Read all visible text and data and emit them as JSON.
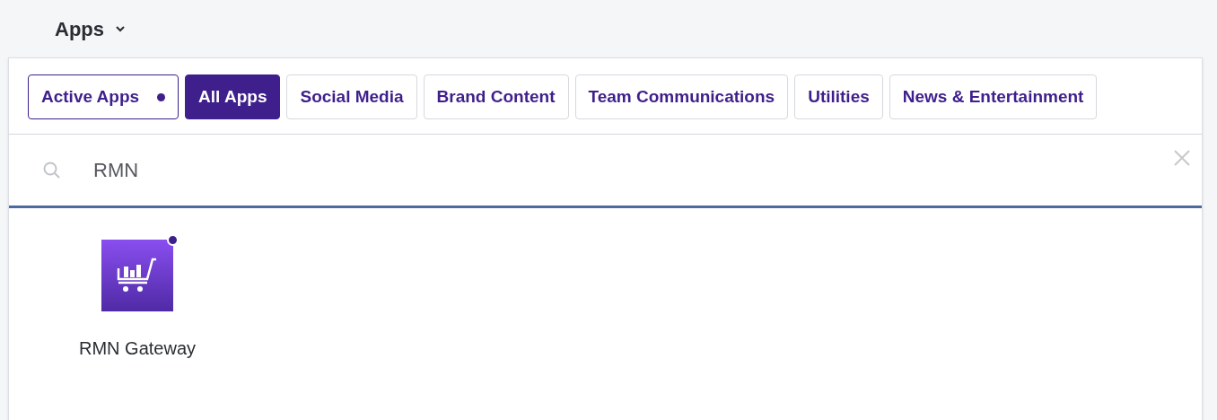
{
  "header": {
    "title": "Apps"
  },
  "tabs": [
    {
      "label": "Active Apps",
      "selected": false,
      "indicator": true
    },
    {
      "label": "All Apps",
      "selected": true,
      "indicator": false
    },
    {
      "label": "Social Media",
      "selected": false,
      "indicator": false
    },
    {
      "label": "Brand Content",
      "selected": false,
      "indicator": false
    },
    {
      "label": "Team Communications",
      "selected": false,
      "indicator": false
    },
    {
      "label": "Utilities",
      "selected": false,
      "indicator": false
    },
    {
      "label": "News & Entertainment",
      "selected": false,
      "indicator": false
    }
  ],
  "search": {
    "value": "RMN"
  },
  "apps": [
    {
      "name": "RMN Gateway",
      "active": true
    }
  ]
}
